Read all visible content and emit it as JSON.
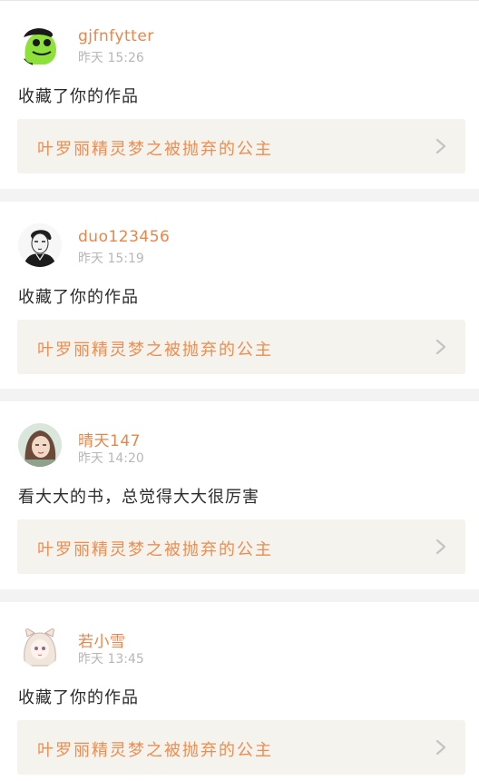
{
  "colors": {
    "accent": "#e9864a",
    "timestamp": "#b7b7b7",
    "message_text": "#2b2b2b",
    "link_background": "#f4f3ee",
    "page_background": "#f3f3f3"
  },
  "notifications": [
    {
      "user": "gjfnfytter",
      "time": "昨天 15:26",
      "message": "收藏了你的作品",
      "work_title": "叶罗丽精灵梦之被抛弃的公主",
      "avatar_icon": "green-frog-avatar-icon"
    },
    {
      "user": "duo123456",
      "time": "昨天 15:19",
      "message": "收藏了你的作品",
      "work_title": "叶罗丽精灵梦之被抛弃的公主",
      "avatar_icon": "sketch-boy-avatar-icon"
    },
    {
      "user": "晴天147",
      "time": "昨天 14:20",
      "message": "看大大的书，总觉得大大很厉害",
      "work_title": "叶罗丽精灵梦之被抛弃的公主",
      "avatar_icon": "photo-girl-avatar-icon"
    },
    {
      "user": "若小雪",
      "time": "昨天 13:45",
      "message": "收藏了你的作品",
      "work_title": "叶罗丽精灵梦之被抛弃的公主",
      "avatar_icon": "anime-girl-avatar-icon"
    }
  ]
}
